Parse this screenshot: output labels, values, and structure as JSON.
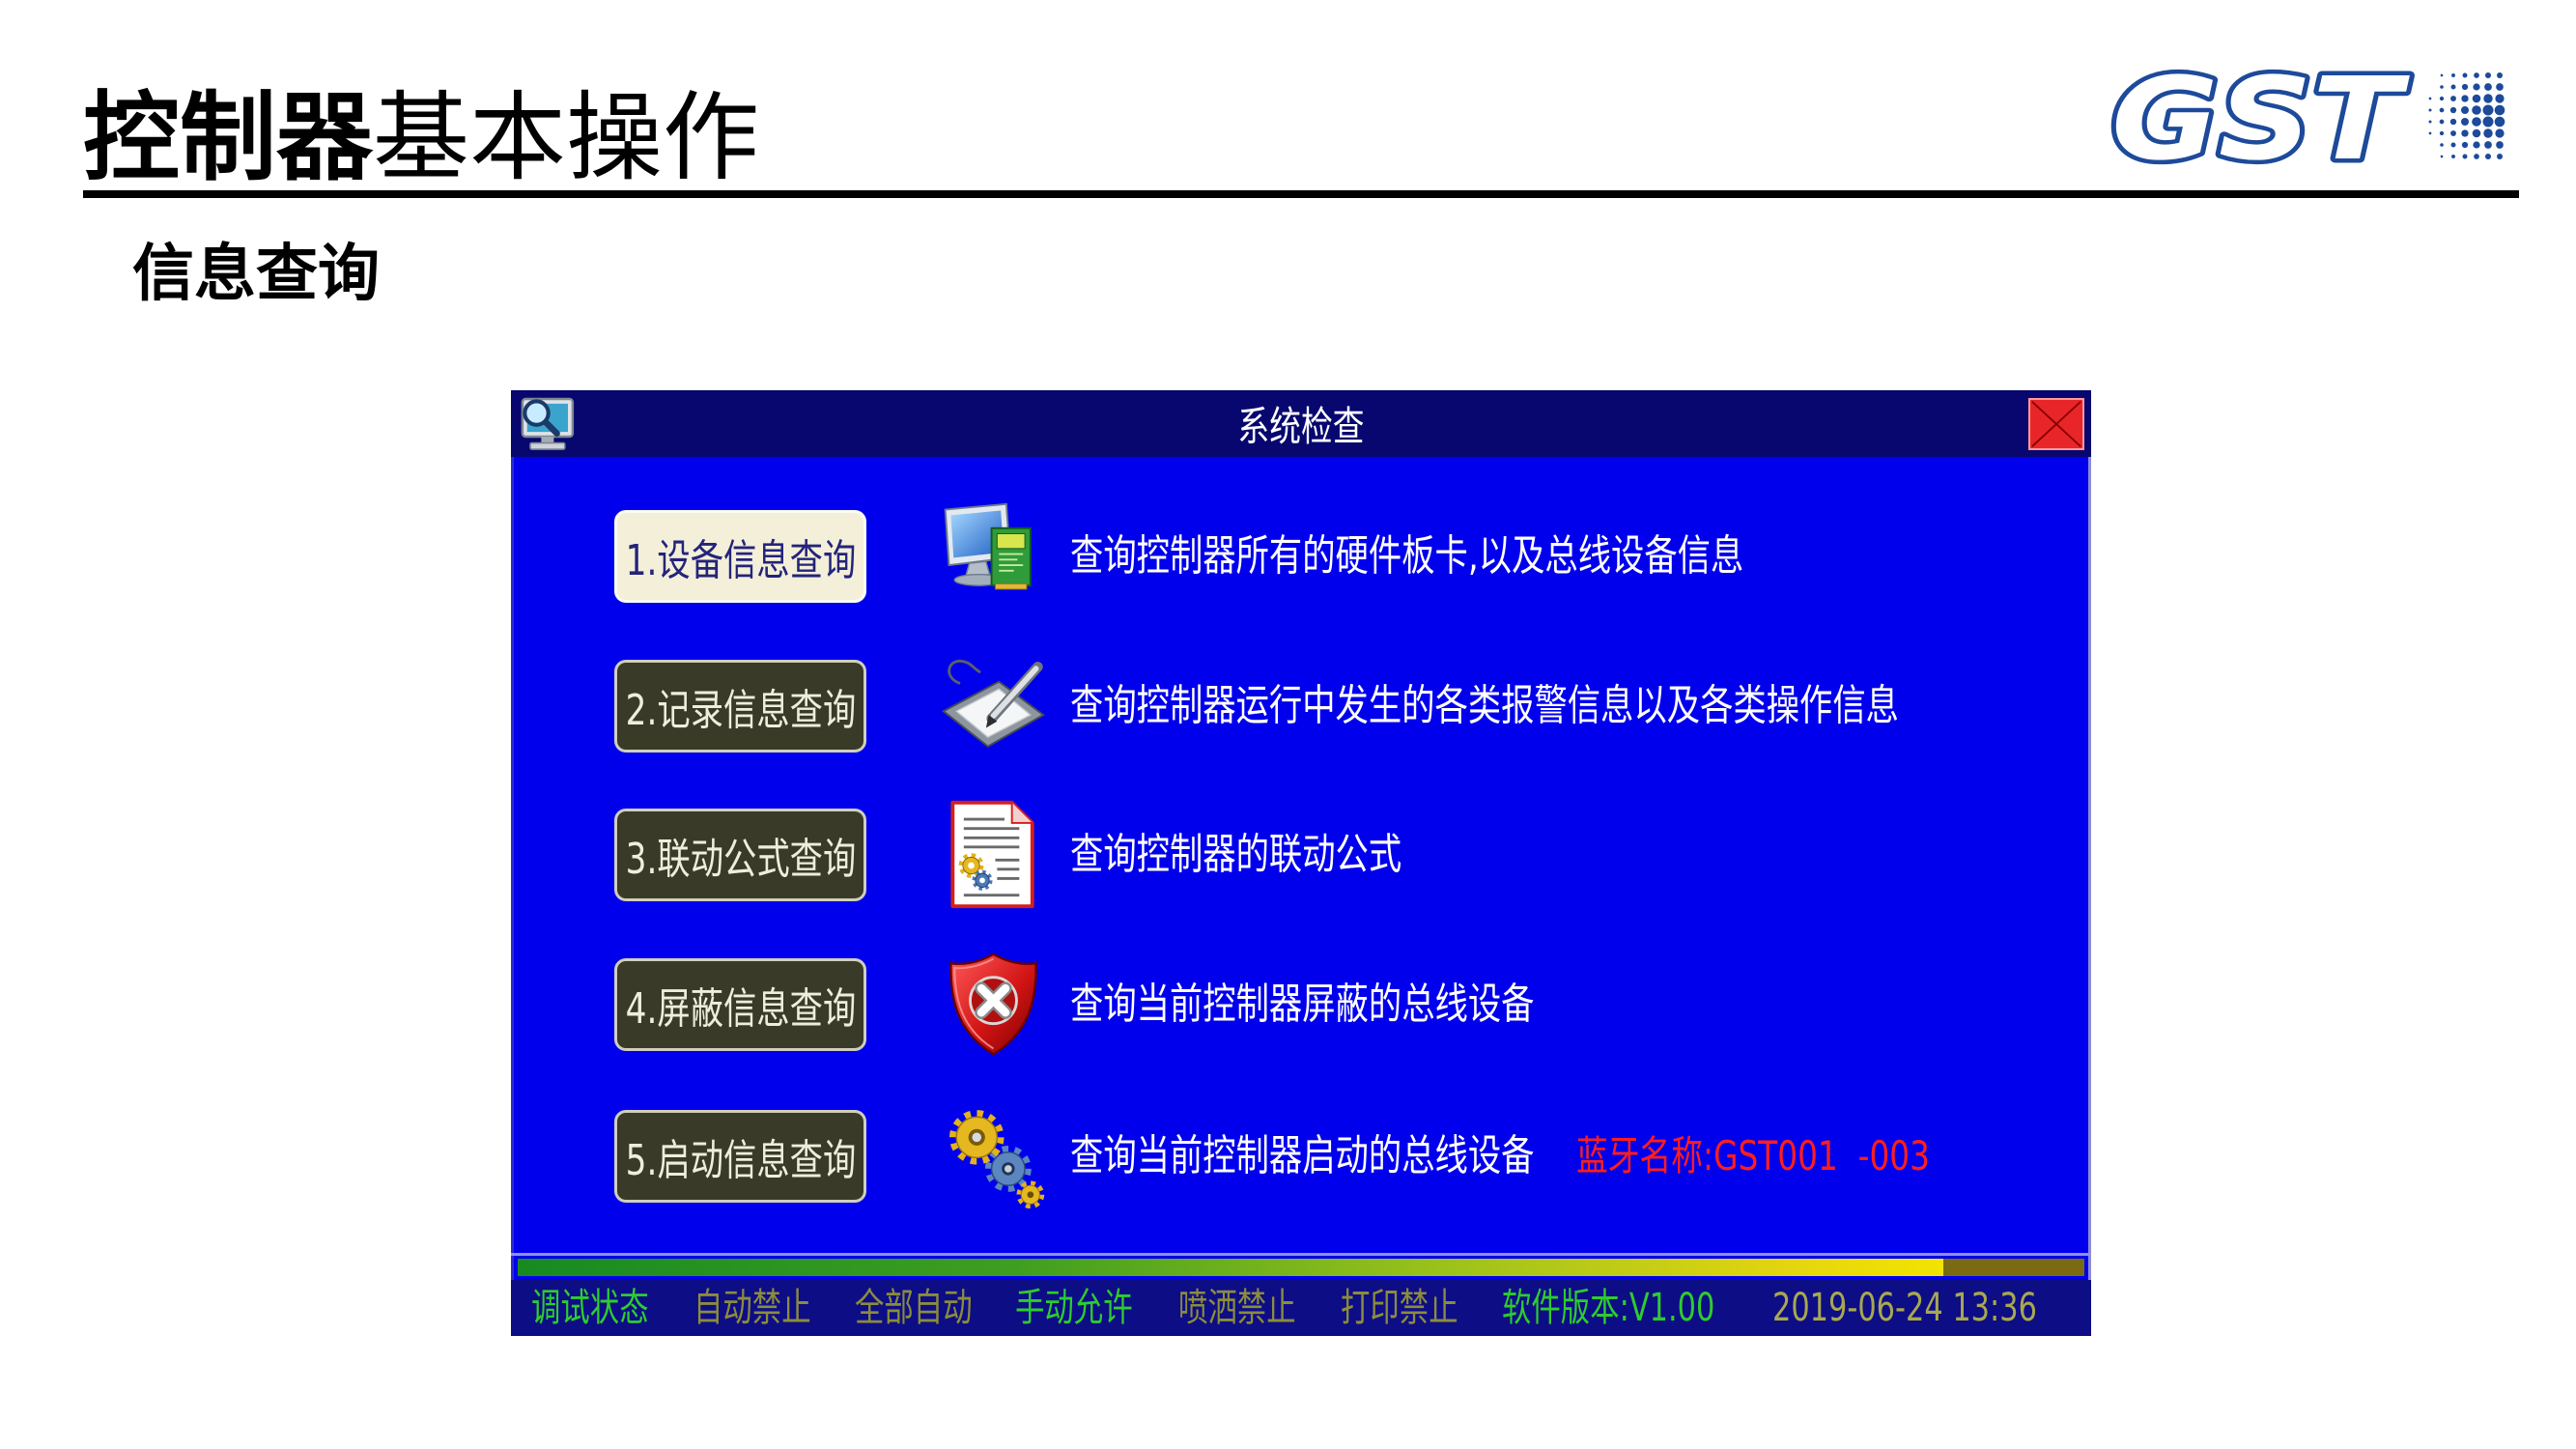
{
  "slide": {
    "title_bold": "控制器",
    "title_regular": "基本操作",
    "subtitle": "信息查询"
  },
  "logo": {
    "text": "GST",
    "color": "#1d4a9a"
  },
  "theme": {
    "window_body": "#0000ec",
    "titlebar": "#07076f",
    "statusbar": "#0d0d86",
    "text": "#ffffff"
  },
  "window": {
    "title": "系统检查",
    "title_icon": "monitor-search-icon",
    "close_icon": "close-icon",
    "rows": [
      {
        "button": "1.设备信息查询",
        "description": "查询控制器所有的硬件板卡,以及总线设备信息",
        "icon": "computer-board-icon",
        "selected": true
      },
      {
        "button": "2.记录信息查询",
        "description": "查询控制器运行中发生的各类报警信息以及各类操作信息",
        "icon": "pen-tablet-icon",
        "selected": false
      },
      {
        "button": "3.联动公式查询",
        "description": "查询控制器的联动公式",
        "icon": "document-gears-icon",
        "selected": false
      },
      {
        "button": "4.屏蔽信息查询",
        "description": "查询当前控制器屏蔽的总线设备",
        "icon": "shield-x-icon",
        "selected": false
      },
      {
        "button": "5.启动信息查询",
        "description": "查询当前控制器启动的总线设备",
        "icon": "gears-icon",
        "selected": false
      }
    ],
    "bluetooth_name": "蓝牙名称:GST001  -003",
    "bluetooth_color": "#ff1e1e",
    "progress": 0.91,
    "status": [
      {
        "text": "调试状态",
        "color": "#2ecc2e"
      },
      {
        "text": "自动禁止",
        "color": "#8c8c3c"
      },
      {
        "text": "全部自动",
        "color": "#8c8c3c"
      },
      {
        "text": "手动允许",
        "color": "#2ecc2e"
      },
      {
        "text": "喷洒禁止",
        "color": "#8c8c3c"
      },
      {
        "text": "打印禁止",
        "color": "#8c8c3c"
      },
      {
        "text": "软件版本:V1.00",
        "color": "#2ecc2e"
      },
      {
        "text": "2019-06-24 13:36",
        "color": "#a8a850"
      }
    ]
  }
}
